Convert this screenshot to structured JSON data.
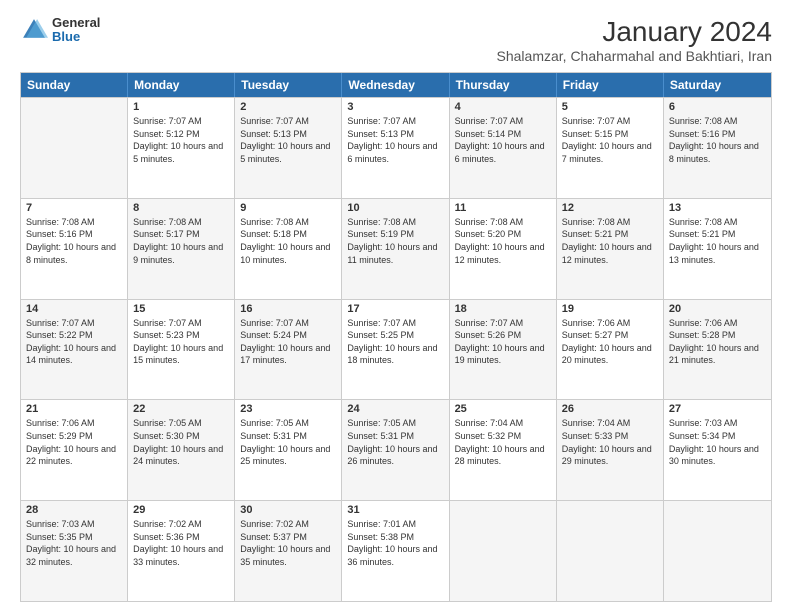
{
  "header": {
    "logo": {
      "general": "General",
      "blue": "Blue"
    },
    "title": "January 2024",
    "subtitle": "Shalamzar, Chaharmahal and Bakhtiari, Iran"
  },
  "weekdays": [
    "Sunday",
    "Monday",
    "Tuesday",
    "Wednesday",
    "Thursday",
    "Friday",
    "Saturday"
  ],
  "weeks": [
    [
      {
        "day": "",
        "sunrise": "",
        "sunset": "",
        "daylight": "",
        "shaded": true
      },
      {
        "day": "1",
        "sunrise": "Sunrise: 7:07 AM",
        "sunset": "Sunset: 5:12 PM",
        "daylight": "Daylight: 10 hours and 5 minutes.",
        "shaded": false
      },
      {
        "day": "2",
        "sunrise": "Sunrise: 7:07 AM",
        "sunset": "Sunset: 5:13 PM",
        "daylight": "Daylight: 10 hours and 5 minutes.",
        "shaded": true
      },
      {
        "day": "3",
        "sunrise": "Sunrise: 7:07 AM",
        "sunset": "Sunset: 5:13 PM",
        "daylight": "Daylight: 10 hours and 6 minutes.",
        "shaded": false
      },
      {
        "day": "4",
        "sunrise": "Sunrise: 7:07 AM",
        "sunset": "Sunset: 5:14 PM",
        "daylight": "Daylight: 10 hours and 6 minutes.",
        "shaded": true
      },
      {
        "day": "5",
        "sunrise": "Sunrise: 7:07 AM",
        "sunset": "Sunset: 5:15 PM",
        "daylight": "Daylight: 10 hours and 7 minutes.",
        "shaded": false
      },
      {
        "day": "6",
        "sunrise": "Sunrise: 7:08 AM",
        "sunset": "Sunset: 5:16 PM",
        "daylight": "Daylight: 10 hours and 8 minutes.",
        "shaded": true
      }
    ],
    [
      {
        "day": "7",
        "sunrise": "Sunrise: 7:08 AM",
        "sunset": "Sunset: 5:16 PM",
        "daylight": "Daylight: 10 hours and 8 minutes.",
        "shaded": false
      },
      {
        "day": "8",
        "sunrise": "Sunrise: 7:08 AM",
        "sunset": "Sunset: 5:17 PM",
        "daylight": "Daylight: 10 hours and 9 minutes.",
        "shaded": true
      },
      {
        "day": "9",
        "sunrise": "Sunrise: 7:08 AM",
        "sunset": "Sunset: 5:18 PM",
        "daylight": "Daylight: 10 hours and 10 minutes.",
        "shaded": false
      },
      {
        "day": "10",
        "sunrise": "Sunrise: 7:08 AM",
        "sunset": "Sunset: 5:19 PM",
        "daylight": "Daylight: 10 hours and 11 minutes.",
        "shaded": true
      },
      {
        "day": "11",
        "sunrise": "Sunrise: 7:08 AM",
        "sunset": "Sunset: 5:20 PM",
        "daylight": "Daylight: 10 hours and 12 minutes.",
        "shaded": false
      },
      {
        "day": "12",
        "sunrise": "Sunrise: 7:08 AM",
        "sunset": "Sunset: 5:21 PM",
        "daylight": "Daylight: 10 hours and 12 minutes.",
        "shaded": true
      },
      {
        "day": "13",
        "sunrise": "Sunrise: 7:08 AM",
        "sunset": "Sunset: 5:21 PM",
        "daylight": "Daylight: 10 hours and 13 minutes.",
        "shaded": false
      }
    ],
    [
      {
        "day": "14",
        "sunrise": "Sunrise: 7:07 AM",
        "sunset": "Sunset: 5:22 PM",
        "daylight": "Daylight: 10 hours and 14 minutes.",
        "shaded": true
      },
      {
        "day": "15",
        "sunrise": "Sunrise: 7:07 AM",
        "sunset": "Sunset: 5:23 PM",
        "daylight": "Daylight: 10 hours and 15 minutes.",
        "shaded": false
      },
      {
        "day": "16",
        "sunrise": "Sunrise: 7:07 AM",
        "sunset": "Sunset: 5:24 PM",
        "daylight": "Daylight: 10 hours and 17 minutes.",
        "shaded": true
      },
      {
        "day": "17",
        "sunrise": "Sunrise: 7:07 AM",
        "sunset": "Sunset: 5:25 PM",
        "daylight": "Daylight: 10 hours and 18 minutes.",
        "shaded": false
      },
      {
        "day": "18",
        "sunrise": "Sunrise: 7:07 AM",
        "sunset": "Sunset: 5:26 PM",
        "daylight": "Daylight: 10 hours and 19 minutes.",
        "shaded": true
      },
      {
        "day": "19",
        "sunrise": "Sunrise: 7:06 AM",
        "sunset": "Sunset: 5:27 PM",
        "daylight": "Daylight: 10 hours and 20 minutes.",
        "shaded": false
      },
      {
        "day": "20",
        "sunrise": "Sunrise: 7:06 AM",
        "sunset": "Sunset: 5:28 PM",
        "daylight": "Daylight: 10 hours and 21 minutes.",
        "shaded": true
      }
    ],
    [
      {
        "day": "21",
        "sunrise": "Sunrise: 7:06 AM",
        "sunset": "Sunset: 5:29 PM",
        "daylight": "Daylight: 10 hours and 22 minutes.",
        "shaded": false
      },
      {
        "day": "22",
        "sunrise": "Sunrise: 7:05 AM",
        "sunset": "Sunset: 5:30 PM",
        "daylight": "Daylight: 10 hours and 24 minutes.",
        "shaded": true
      },
      {
        "day": "23",
        "sunrise": "Sunrise: 7:05 AM",
        "sunset": "Sunset: 5:31 PM",
        "daylight": "Daylight: 10 hours and 25 minutes.",
        "shaded": false
      },
      {
        "day": "24",
        "sunrise": "Sunrise: 7:05 AM",
        "sunset": "Sunset: 5:31 PM",
        "daylight": "Daylight: 10 hours and 26 minutes.",
        "shaded": true
      },
      {
        "day": "25",
        "sunrise": "Sunrise: 7:04 AM",
        "sunset": "Sunset: 5:32 PM",
        "daylight": "Daylight: 10 hours and 28 minutes.",
        "shaded": false
      },
      {
        "day": "26",
        "sunrise": "Sunrise: 7:04 AM",
        "sunset": "Sunset: 5:33 PM",
        "daylight": "Daylight: 10 hours and 29 minutes.",
        "shaded": true
      },
      {
        "day": "27",
        "sunrise": "Sunrise: 7:03 AM",
        "sunset": "Sunset: 5:34 PM",
        "daylight": "Daylight: 10 hours and 30 minutes.",
        "shaded": false
      }
    ],
    [
      {
        "day": "28",
        "sunrise": "Sunrise: 7:03 AM",
        "sunset": "Sunset: 5:35 PM",
        "daylight": "Daylight: 10 hours and 32 minutes.",
        "shaded": true
      },
      {
        "day": "29",
        "sunrise": "Sunrise: 7:02 AM",
        "sunset": "Sunset: 5:36 PM",
        "daylight": "Daylight: 10 hours and 33 minutes.",
        "shaded": false
      },
      {
        "day": "30",
        "sunrise": "Sunrise: 7:02 AM",
        "sunset": "Sunset: 5:37 PM",
        "daylight": "Daylight: 10 hours and 35 minutes.",
        "shaded": true
      },
      {
        "day": "31",
        "sunrise": "Sunrise: 7:01 AM",
        "sunset": "Sunset: 5:38 PM",
        "daylight": "Daylight: 10 hours and 36 minutes.",
        "shaded": false
      },
      {
        "day": "",
        "sunrise": "",
        "sunset": "",
        "daylight": "",
        "shaded": true
      },
      {
        "day": "",
        "sunrise": "",
        "sunset": "",
        "daylight": "",
        "shaded": true
      },
      {
        "day": "",
        "sunrise": "",
        "sunset": "",
        "daylight": "",
        "shaded": true
      }
    ]
  ]
}
